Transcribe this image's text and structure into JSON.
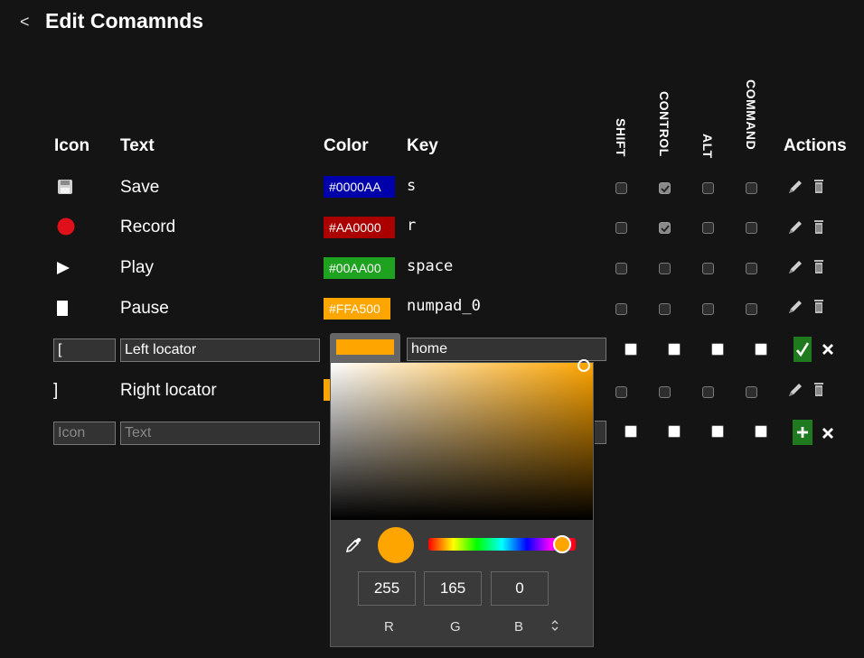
{
  "header": {
    "back_label": "<",
    "title": "Edit Comamnds"
  },
  "columns": {
    "icon": "Icon",
    "text": "Text",
    "color": "Color",
    "key": "Key",
    "shift": "SHIFT",
    "control": "CONTROL",
    "alt": "ALT",
    "command": "COMMAND",
    "actions": "Actions"
  },
  "rows": [
    {
      "text": "Save",
      "color_label": "#0000AA",
      "color": "#0000AA",
      "key": "s",
      "shift": false,
      "control": true,
      "alt": false,
      "command": false
    },
    {
      "text": "Record",
      "color_label": "#AA0000",
      "color": "#AA0000",
      "key": "r",
      "shift": false,
      "control": true,
      "alt": false,
      "command": false
    },
    {
      "text": "Play",
      "color_label": "#00AA00",
      "color": "#00AA00",
      "key": "space",
      "shift": false,
      "control": false,
      "alt": false,
      "command": false
    },
    {
      "text": "Pause",
      "color_label": "#FFA500",
      "color": "#FFA500",
      "key": "numpad_0",
      "shift": false,
      "control": false,
      "alt": false,
      "command": false
    },
    {
      "text": "Right locator",
      "icon_text": "]",
      "color": "#FFA500",
      "shift": false,
      "control": false,
      "alt": false,
      "command": false
    }
  ],
  "editing_row": {
    "icon_value": "[",
    "text_value": "Left locator",
    "color": "#FFA500",
    "key_value": "home"
  },
  "new_row": {
    "icon_placeholder": "Icon",
    "text_placeholder": "Text"
  },
  "picker": {
    "r": "255",
    "g": "165",
    "b": "0",
    "r_label": "R",
    "g_label": "G",
    "b_label": "B",
    "hue_level_percent": 91,
    "color": "#FFA500"
  }
}
